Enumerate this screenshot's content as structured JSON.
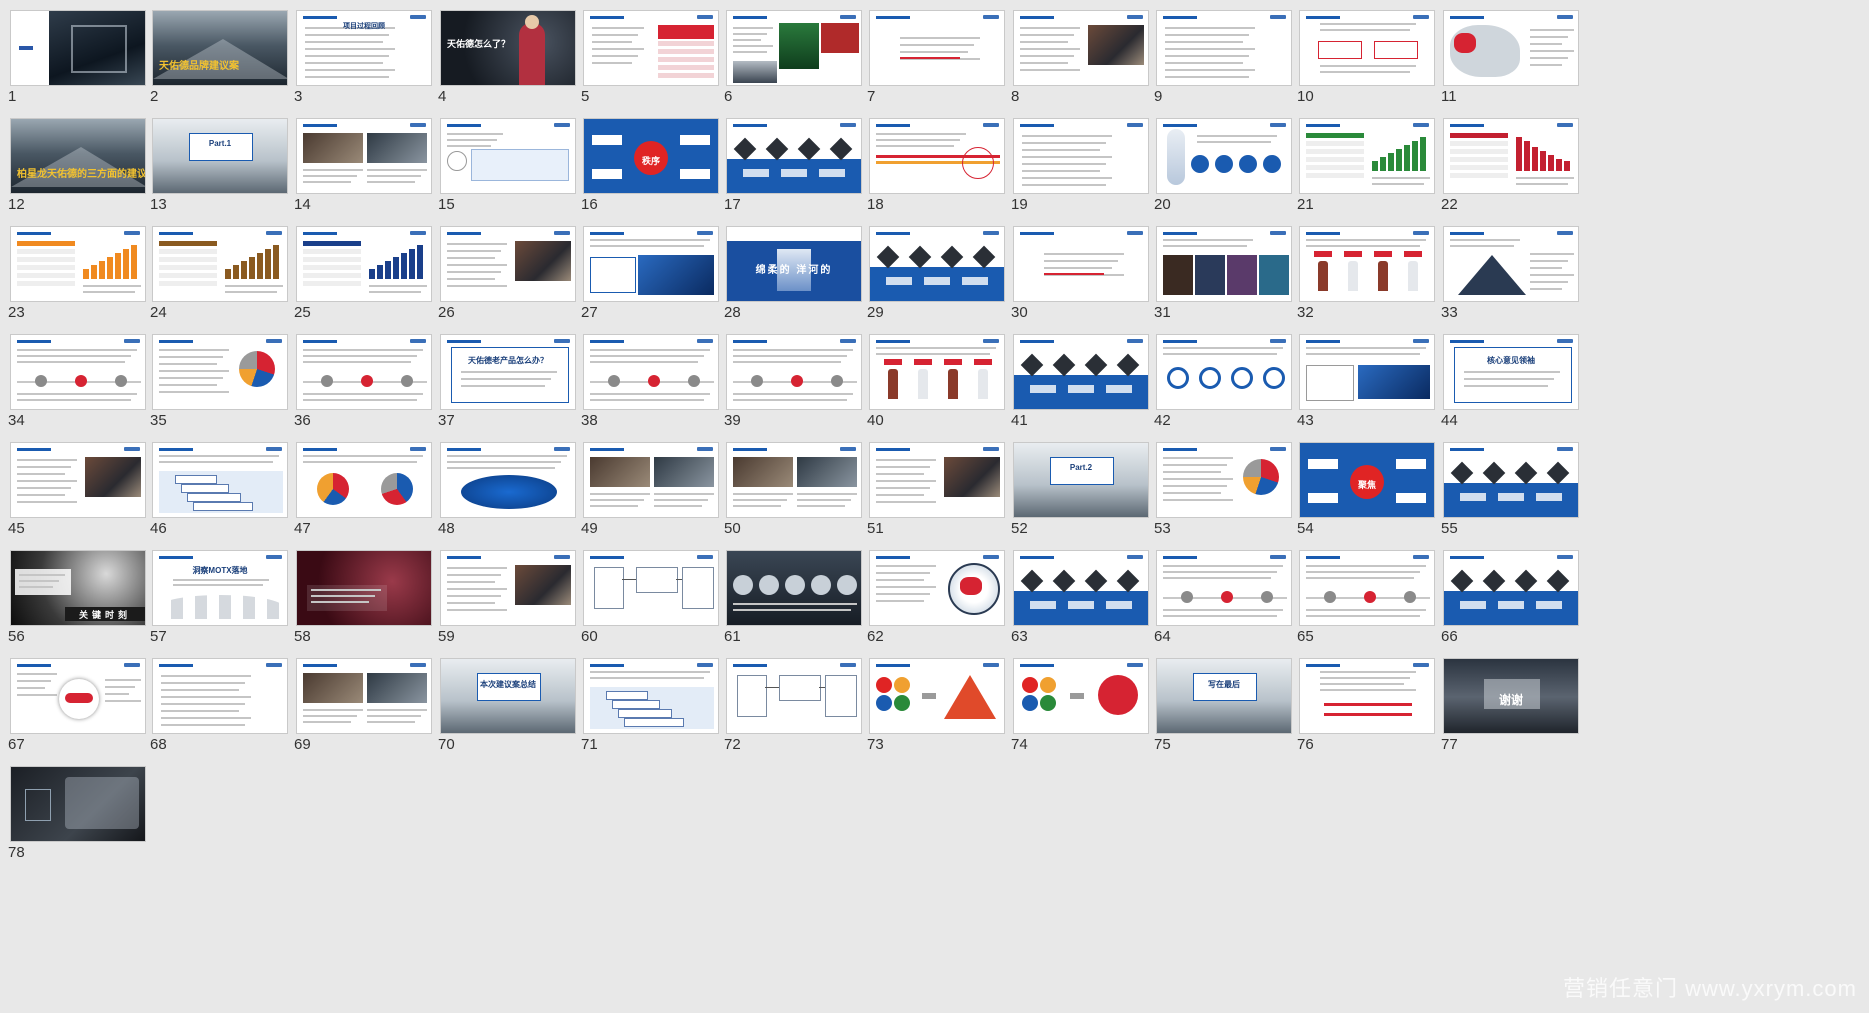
{
  "watermark": "营销任意门 www.yxrym.com",
  "slides": [
    {
      "n": "1",
      "style": "title-dark"
    },
    {
      "n": "2",
      "style": "mountain",
      "title": "天佑德品牌建议案"
    },
    {
      "n": "3",
      "style": "text-list",
      "title": "项目过程回顾"
    },
    {
      "n": "4",
      "style": "person-dark",
      "title": "天佑德怎么了？"
    },
    {
      "n": "5",
      "style": "table-red"
    },
    {
      "n": "6",
      "style": "mixed-photo"
    },
    {
      "n": "7",
      "style": "text-center"
    },
    {
      "n": "8",
      "style": "text-photo"
    },
    {
      "n": "9",
      "style": "text-list"
    },
    {
      "n": "10",
      "style": "text-red-boxes"
    },
    {
      "n": "11",
      "style": "map"
    },
    {
      "n": "12",
      "style": "mountain",
      "title": "柏星龙天佑德的三方面的建议"
    },
    {
      "n": "13",
      "style": "mountain-box",
      "title": "Part.1"
    },
    {
      "n": "14",
      "style": "photos"
    },
    {
      "n": "15",
      "style": "text-diagram"
    },
    {
      "n": "16",
      "style": "blue-diagram",
      "title": "秩序"
    },
    {
      "n": "17",
      "style": "blue-diamonds"
    },
    {
      "n": "18",
      "style": "text-chart"
    },
    {
      "n": "19",
      "style": "text-list"
    },
    {
      "n": "20",
      "style": "bubbles"
    },
    {
      "n": "21",
      "style": "chart-green"
    },
    {
      "n": "22",
      "style": "chart-red"
    },
    {
      "n": "23",
      "style": "chart-orange"
    },
    {
      "n": "24",
      "style": "chart-brown"
    },
    {
      "n": "25",
      "style": "chart-navy"
    },
    {
      "n": "26",
      "style": "text-photo"
    },
    {
      "n": "27",
      "style": "bottles-blue"
    },
    {
      "n": "28",
      "style": "blue-banner",
      "title": "绵柔的 洋河的"
    },
    {
      "n": "29",
      "style": "blue-diamonds"
    },
    {
      "n": "30",
      "style": "text-center"
    },
    {
      "n": "31",
      "style": "photo-strip"
    },
    {
      "n": "32",
      "style": "bottles"
    },
    {
      "n": "33",
      "style": "pyramid"
    },
    {
      "n": "34",
      "style": "timeline-red"
    },
    {
      "n": "35",
      "style": "text-pie"
    },
    {
      "n": "36",
      "style": "timeline-red"
    },
    {
      "n": "37",
      "style": "text-box",
      "title": "天佑德老产品怎么办？"
    },
    {
      "n": "38",
      "style": "timeline-red"
    },
    {
      "n": "39",
      "style": "timeline-red"
    },
    {
      "n": "40",
      "style": "bottles"
    },
    {
      "n": "41",
      "style": "blue-diamonds"
    },
    {
      "n": "42",
      "style": "circles-blue"
    },
    {
      "n": "43",
      "style": "text-boxes"
    },
    {
      "n": "44",
      "style": "text-box",
      "title": "核心意见领袖"
    },
    {
      "n": "45",
      "style": "text-photo"
    },
    {
      "n": "46",
      "style": "pyramid-box"
    },
    {
      "n": "47",
      "style": "pies"
    },
    {
      "n": "48",
      "style": "ellipse"
    },
    {
      "n": "49",
      "style": "photos"
    },
    {
      "n": "50",
      "style": "photos"
    },
    {
      "n": "51",
      "style": "text-photo"
    },
    {
      "n": "52",
      "style": "mountain-box",
      "title": "Part.2"
    },
    {
      "n": "53",
      "style": "text-pie"
    },
    {
      "n": "54",
      "style": "blue-diagram",
      "title": "聚焦"
    },
    {
      "n": "55",
      "style": "blue-diamonds"
    },
    {
      "n": "56",
      "style": "truth-dark",
      "title": "关键时刻"
    },
    {
      "n": "57",
      "style": "wave",
      "title": "洞察MOTX落地"
    },
    {
      "n": "58",
      "style": "dark-red"
    },
    {
      "n": "59",
      "style": "text-photo"
    },
    {
      "n": "60",
      "style": "flow"
    },
    {
      "n": "61",
      "style": "dark-circles"
    },
    {
      "n": "62",
      "style": "globe"
    },
    {
      "n": "63",
      "style": "blue-diamonds"
    },
    {
      "n": "64",
      "style": "timeline-red"
    },
    {
      "n": "65",
      "style": "timeline-red"
    },
    {
      "n": "66",
      "style": "blue-diamonds"
    },
    {
      "n": "67",
      "style": "pill"
    },
    {
      "n": "68",
      "style": "text-list"
    },
    {
      "n": "69",
      "style": "photos"
    },
    {
      "n": "70",
      "style": "mountain-box",
      "title": "本次建议案总结"
    },
    {
      "n": "71",
      "style": "pyramid-box"
    },
    {
      "n": "72",
      "style": "flow"
    },
    {
      "n": "73",
      "style": "color-pyramid"
    },
    {
      "n": "74",
      "style": "color-circles"
    },
    {
      "n": "75",
      "style": "mountain-box",
      "title": "写在最后"
    },
    {
      "n": "76",
      "style": "text-red-lines"
    },
    {
      "n": "77",
      "style": "temple-dark",
      "title": "谢谢"
    },
    {
      "n": "78",
      "style": "logo-dark"
    }
  ]
}
